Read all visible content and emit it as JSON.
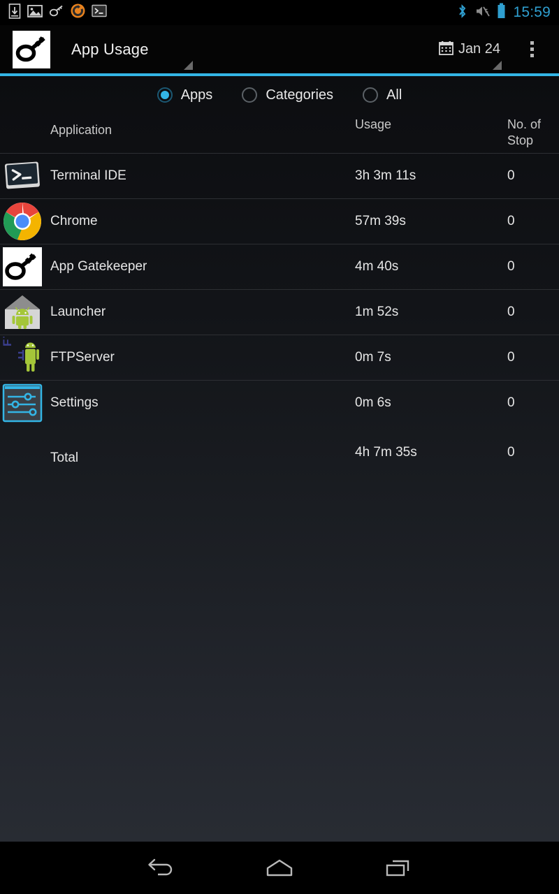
{
  "status_bar": {
    "time": "15:59",
    "left_icons": [
      "download-icon",
      "image-icon",
      "key-icon",
      "sync-icon",
      "terminal-icon"
    ],
    "right_icons": [
      "bluetooth-icon",
      "volume-muted-icon",
      "battery-icon"
    ],
    "accent_color": "#2f9fd0"
  },
  "action_bar": {
    "logo_icon": "app-gatekeeper-key-icon",
    "title": "App Usage",
    "date_icon": "calendar-icon",
    "date_label": "Jan 24",
    "overflow_icon": "overflow-menu-icon",
    "underline_color": "#33b5e5"
  },
  "filter": {
    "options": [
      {
        "label": "Apps",
        "selected": true
      },
      {
        "label": "Categories",
        "selected": false
      },
      {
        "label": "All",
        "selected": false
      }
    ]
  },
  "table": {
    "headers": {
      "application": "Application",
      "usage": "Usage",
      "stops": "No. of Stop"
    },
    "rows": [
      {
        "icon": "terminal-ide-icon",
        "app": "Terminal IDE",
        "usage": "3h 3m 11s",
        "stops": "0"
      },
      {
        "icon": "chrome-icon",
        "app": "Chrome",
        "usage": "57m 39s",
        "stops": "0"
      },
      {
        "icon": "app-gatekeeper-icon",
        "app": "App Gatekeeper",
        "usage": "4m 40s",
        "stops": "0"
      },
      {
        "icon": "launcher-icon",
        "app": "Launcher",
        "usage": "1m 52s",
        "stops": "0"
      },
      {
        "icon": "ftpserver-icon",
        "app": "FTPServer",
        "usage": "0m 7s",
        "stops": "0"
      },
      {
        "icon": "settings-icon",
        "app": "Settings",
        "usage": "0m 6s",
        "stops": "0"
      }
    ],
    "total": {
      "app": "Total",
      "usage": "4h 7m 35s",
      "stops": "0"
    }
  },
  "nav_bar": {
    "buttons": [
      "back-icon",
      "home-icon",
      "recents-icon"
    ]
  }
}
